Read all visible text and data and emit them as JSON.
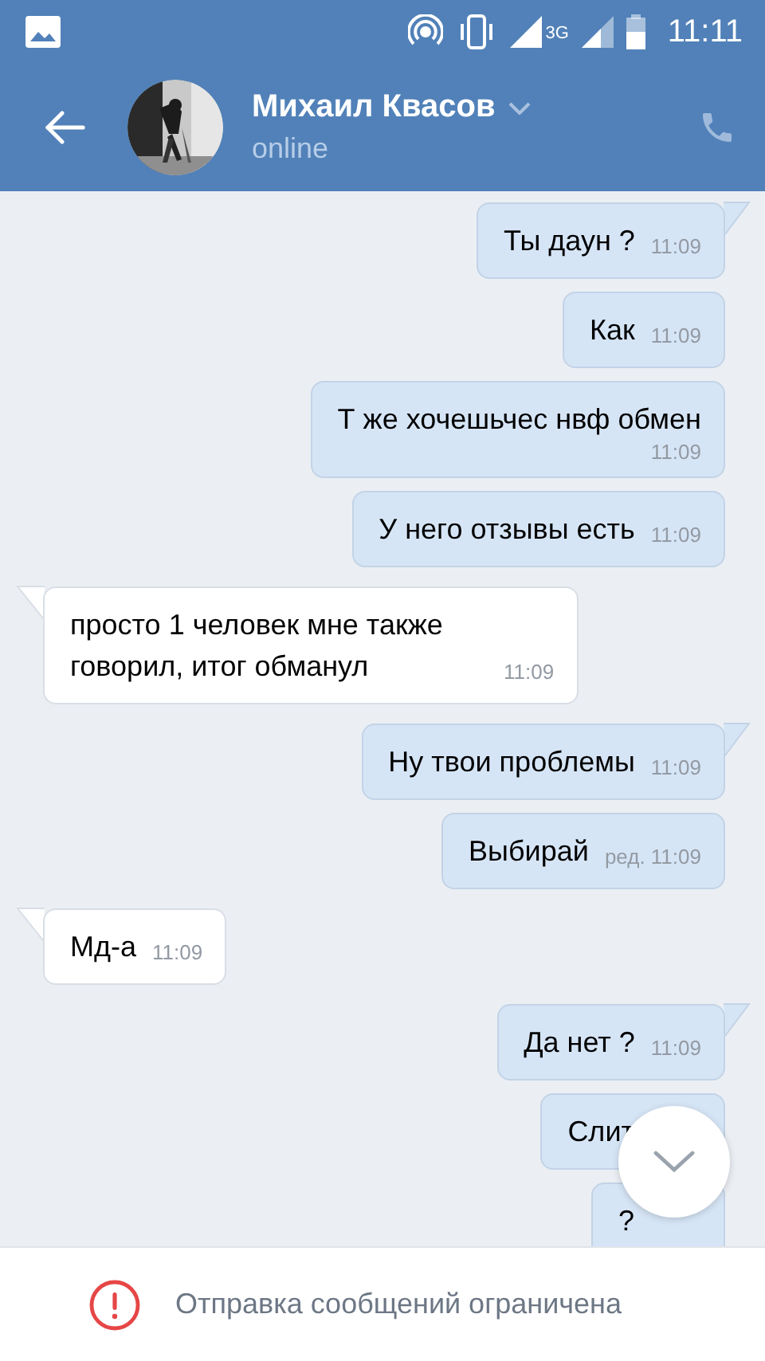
{
  "status_bar": {
    "network": "3G",
    "time": "11:11"
  },
  "header": {
    "name": "Михаил Квасов",
    "status": "online"
  },
  "messages": [
    {
      "kind": "outgoing",
      "tail": true,
      "text": "Ты даун ?",
      "time": "11:09",
      "time_wrapped": false
    },
    {
      "kind": "outgoing",
      "tail": false,
      "text": "Как",
      "time": "11:09",
      "time_wrapped": false
    },
    {
      "kind": "outgoing",
      "tail": false,
      "text": "Т же хочешьчес нвф обмен",
      "time": "11:09",
      "time_wrapped": true
    },
    {
      "kind": "outgoing",
      "tail": false,
      "text": "У него отзывы есть",
      "time": "11:09",
      "time_wrapped": false
    },
    {
      "kind": "incoming",
      "tail": true,
      "text": "просто 1 человек мне также говорил, итог обманул",
      "time": "11:09",
      "time_wrapped": false
    },
    {
      "kind": "outgoing",
      "tail": true,
      "text": "Ну твои проблемы",
      "time": "11:09",
      "time_wrapped": false
    },
    {
      "kind": "outgoing",
      "tail": false,
      "text": "Выбирай",
      "time": "ред. 11:09",
      "time_wrapped": false
    },
    {
      "kind": "incoming",
      "tail": true,
      "text": "Мд-а",
      "time": "11:09",
      "time_wrapped": false
    },
    {
      "kind": "outgoing",
      "tail": true,
      "text": "Да нет ?",
      "time": "11:09",
      "time_wrapped": false
    },
    {
      "kind": "outgoing",
      "tail": false,
      "text": "Слит",
      "time_wrapped": false
    },
    {
      "kind": "outgoing",
      "tail": false,
      "text": "?",
      "time_wrapped": false
    }
  ],
  "notice": {
    "text": "Отправка сообщений ограничена"
  }
}
